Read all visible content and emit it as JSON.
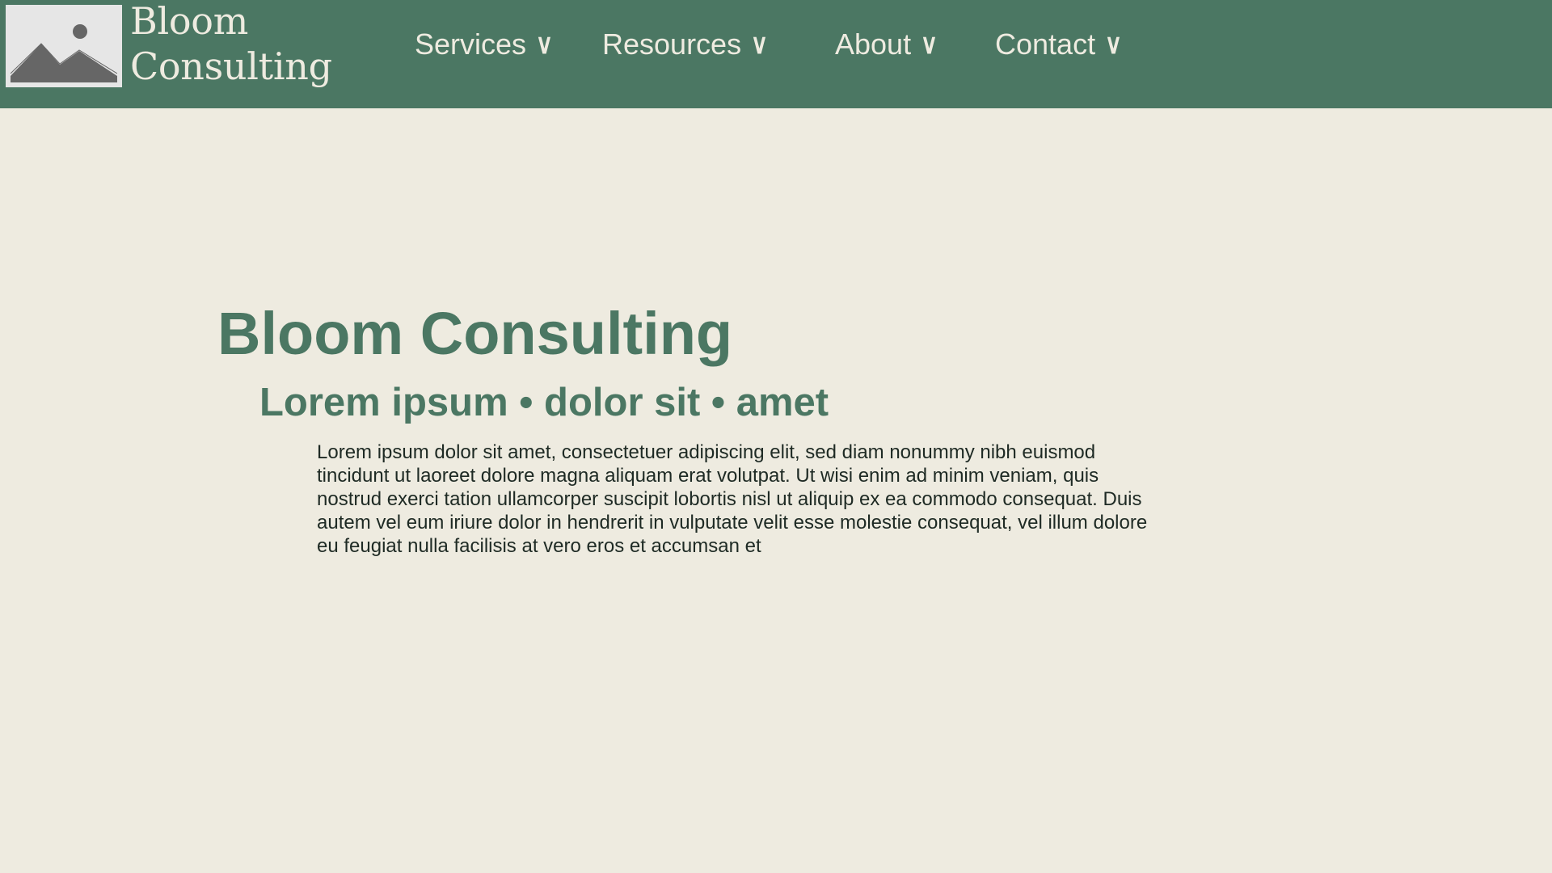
{
  "brand": {
    "name": "Bloom Consulting",
    "logo_icon": "image-placeholder-icon",
    "logo_colors": {
      "frame": "#e6e6e6",
      "picture": "#666666"
    }
  },
  "navigation": {
    "items": [
      {
        "label": "Services",
        "chevron": "∨",
        "icon": "chevron-down-icon"
      },
      {
        "label": "Resources",
        "chevron": "∨",
        "icon": "chevron-down-icon"
      },
      {
        "label": "About",
        "chevron": "∨",
        "icon": "chevron-down-icon"
      },
      {
        "label": "Contact",
        "chevron": "∨",
        "icon": "chevron-down-icon"
      }
    ]
  },
  "hero": {
    "title": "Bloom Consulting",
    "subtitle": "Lorem ipsum • dolor sit • amet",
    "body": "Lorem ipsum dolor sit amet, consectetuer adipiscing elit, sed diam nonummy nibh euismod tincidunt ut laoreet dolore magna aliquam erat volutpat. Ut wisi enim ad minim veniam, quis nostrud exerci tation ullamcorper suscipit lobortis nisl ut aliquip ex ea commodo consequat. Duis autem vel eum iriure dolor in hendrerit in vulputate velit esse molestie consequat, vel illum dolore eu feugiat nulla facilisis at vero eros et accumsan et"
  },
  "colors": {
    "header_background": "#4b7763",
    "page_background": "#eeebe0",
    "accent_text": "#4b7763",
    "body_text": "#1e2a24",
    "header_text": "#eeebe0"
  }
}
